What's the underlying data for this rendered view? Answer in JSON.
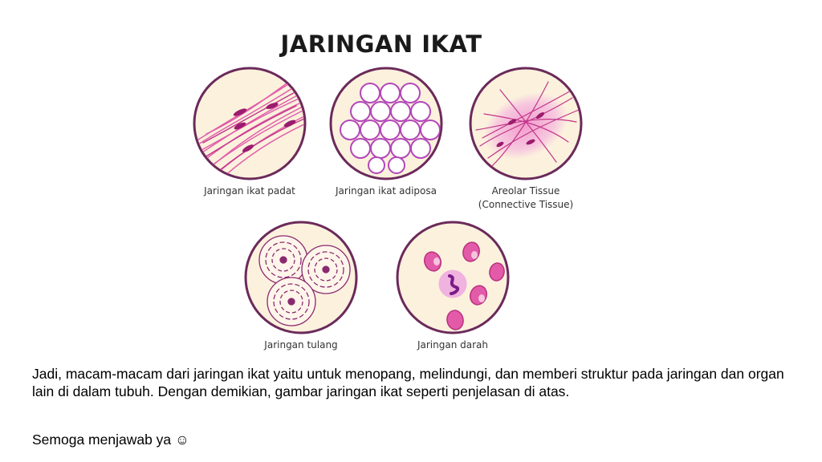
{
  "slide": {
    "title": "JARINGAN IKAT",
    "tissues": [
      {
        "label": "Jaringan ikat padat",
        "icon": "dense-connective-tissue-icon"
      },
      {
        "label": "Jaringan ikat adiposa",
        "icon": "adipose-tissue-icon"
      },
      {
        "label_line1": "Areolar Tissue",
        "label_line2": "(Connective Tissue)",
        "icon": "areolar-tissue-icon"
      },
      {
        "label": "Jaringan tulang",
        "icon": "bone-tissue-icon"
      },
      {
        "label": "Jaringan darah",
        "icon": "blood-tissue-icon"
      }
    ],
    "paragraph": "Jadi, macam-macam dari jaringan ikat yaitu untuk menopang, melindungi, dan memberi struktur pada jaringan dan organ lain di dalam tubuh. Dengan demikian, gambar jaringan ikat seperti penjelasan di atas.",
    "closing": "Semoga menjawab ya ☺"
  },
  "colors": {
    "circle_fill": "#fbf1dd",
    "circle_border": "#6b2a5a",
    "pink": "#e25aa8",
    "magenta": "#9b1c6e",
    "light_pink": "#f2b4d8"
  }
}
